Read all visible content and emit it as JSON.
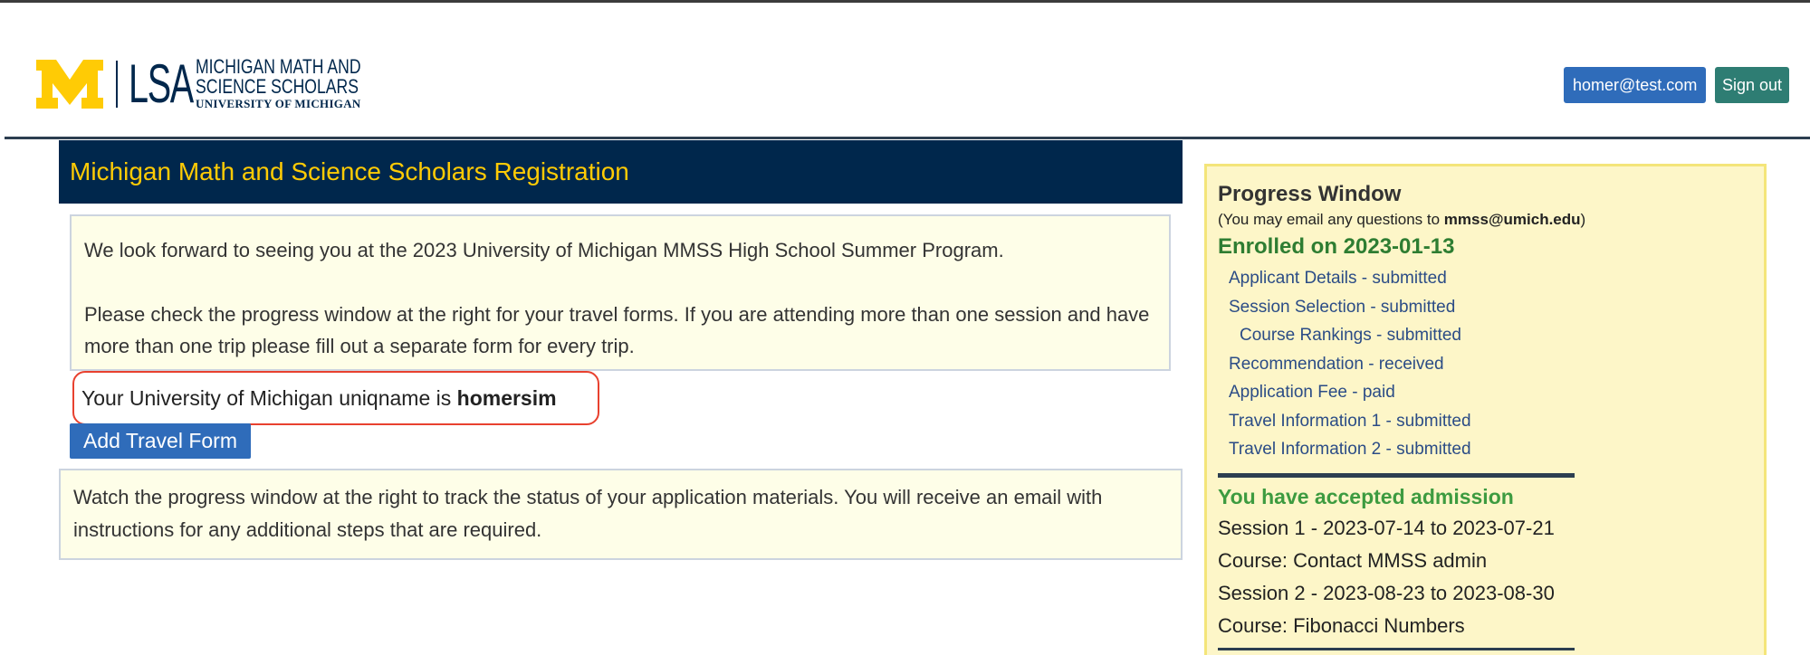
{
  "header": {
    "logo": {
      "lsa": "LSA",
      "line1": "MICHIGAN MATH AND",
      "line2": "SCIENCE SCHOLARS",
      "line3": "UNIVERSITY OF MICHIGAN"
    },
    "user_email": "homer@test.com",
    "sign_out": "Sign out"
  },
  "main": {
    "title": "Michigan Math and Science Scholars Registration",
    "info": {
      "paragraph1": "We look forward to seeing you at the 2023 University of Michigan MMSS High School Summer Program.",
      "paragraph2": "Please check the progress window at the right for your travel forms. If you are attending more than one session and have more than one trip please fill out a separate form for every trip."
    },
    "uniqname_prefix": "Your University of Michigan uniqname is ",
    "uniqname": "homersim",
    "add_travel_form": "Add Travel Form",
    "watch_text": "Watch the progress window at the right to track the status of your application materials. You will receive an email with instructions for any additional steps that are required."
  },
  "progress": {
    "title": "Progress Window",
    "note_prefix": "(You may email any questions to ",
    "note_email": "mmss@umich.edu",
    "note_suffix": ")",
    "enrolled": "Enrolled on 2023-01-13",
    "items": [
      {
        "label": "Applicant Details - submitted"
      },
      {
        "label": "Session Selection - submitted"
      },
      {
        "label": "Course Rankings - submitted"
      },
      {
        "label": "Recommendation - received"
      },
      {
        "label": "Application Fee - paid"
      },
      {
        "label": "Travel Information 1 - submitted"
      },
      {
        "label": "Travel Information 2 - submitted"
      }
    ],
    "accepted": "You have accepted admission",
    "sessions": [
      "Session 1 - 2023-07-14 to 2023-07-21",
      "Course: Contact MMSS admin",
      "Session 2 - 2023-08-23 to 2023-08-30",
      "Course: Fibonacci Numbers"
    ]
  },
  "colors": {
    "navy": "#00274c",
    "maize": "#ffcb05",
    "button_blue": "#2f6cba",
    "button_teal": "#2e7d73",
    "highlight_red": "#e8412f"
  }
}
